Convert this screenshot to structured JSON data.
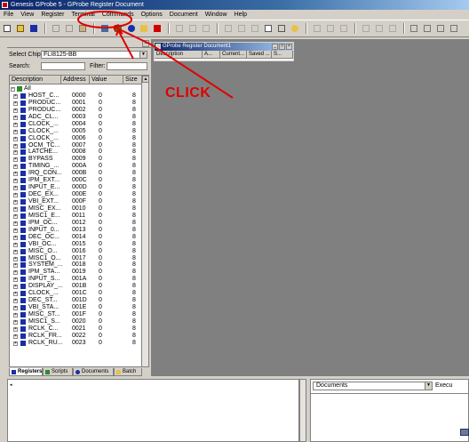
{
  "window": {
    "title": "Genesis GProbe 5 - GProbe Register Document"
  },
  "menu": [
    "File",
    "View",
    "Register",
    "Terminal",
    "Commands",
    "Options",
    "Document",
    "Window",
    "Help"
  ],
  "left_pane": {
    "select_chip_label": "Select Chip:",
    "select_chip_value": "FLI8125-BB",
    "search_label": "Search:",
    "search_value": "",
    "filter_label": "Filter:",
    "filter_value": "",
    "columns": [
      "Description",
      "Address",
      "Value",
      "Size"
    ],
    "root_label": "All",
    "rows": [
      {
        "name": "HOST_C...",
        "addr": "0000",
        "val": "0",
        "size": "8"
      },
      {
        "name": "PRODUC...",
        "addr": "0001",
        "val": "0",
        "size": "8"
      },
      {
        "name": "PRODUC...",
        "addr": "0002",
        "val": "0",
        "size": "8"
      },
      {
        "name": "ADC_CL...",
        "addr": "0003",
        "val": "0",
        "size": "8"
      },
      {
        "name": "CLOCK_...",
        "addr": "0004",
        "val": "0",
        "size": "8"
      },
      {
        "name": "CLOCK_...",
        "addr": "0005",
        "val": "0",
        "size": "8"
      },
      {
        "name": "CLOCK_...",
        "addr": "0006",
        "val": "0",
        "size": "8"
      },
      {
        "name": "OCM_TC...",
        "addr": "0007",
        "val": "0",
        "size": "8"
      },
      {
        "name": "LATCHE...",
        "addr": "0008",
        "val": "0",
        "size": "8"
      },
      {
        "name": "BYPASS",
        "addr": "0009",
        "val": "0",
        "size": "8"
      },
      {
        "name": "TIMING_...",
        "addr": "000A",
        "val": "0",
        "size": "8"
      },
      {
        "name": "IRQ_CON...",
        "addr": "000B",
        "val": "0",
        "size": "8"
      },
      {
        "name": "IPM_EXT...",
        "addr": "000C",
        "val": "0",
        "size": "8"
      },
      {
        "name": "INPUT_E...",
        "addr": "000D",
        "val": "0",
        "size": "8"
      },
      {
        "name": "DEC_EX...",
        "addr": "000E",
        "val": "0",
        "size": "8"
      },
      {
        "name": "VBI_EXT...",
        "addr": "000F",
        "val": "0",
        "size": "8"
      },
      {
        "name": "MISC_EX...",
        "addr": "0010",
        "val": "0",
        "size": "8"
      },
      {
        "name": "MISC1_E...",
        "addr": "0011",
        "val": "0",
        "size": "8"
      },
      {
        "name": "IPM_OC...",
        "addr": "0012",
        "val": "0",
        "size": "8"
      },
      {
        "name": "INPUT_0...",
        "addr": "0013",
        "val": "0",
        "size": "8"
      },
      {
        "name": "DEC_OC...",
        "addr": "0014",
        "val": "0",
        "size": "8"
      },
      {
        "name": "VBI_OC...",
        "addr": "0015",
        "val": "0",
        "size": "8"
      },
      {
        "name": "MISC_O...",
        "addr": "0016",
        "val": "0",
        "size": "8"
      },
      {
        "name": "MISC1_O...",
        "addr": "0017",
        "val": "0",
        "size": "8"
      },
      {
        "name": "SYSTEM_...",
        "addr": "0018",
        "val": "0",
        "size": "8"
      },
      {
        "name": "IPM_STA...",
        "addr": "0019",
        "val": "0",
        "size": "8"
      },
      {
        "name": "INPUT_S...",
        "addr": "001A",
        "val": "0",
        "size": "8"
      },
      {
        "name": "DISPLAY_...",
        "addr": "001B",
        "val": "0",
        "size": "8"
      },
      {
        "name": "CLOCK_...",
        "addr": "001C",
        "val": "0",
        "size": "8"
      },
      {
        "name": "DEC_ST...",
        "addr": "001D",
        "val": "0",
        "size": "8"
      },
      {
        "name": "VBI_STA...",
        "addr": "001E",
        "val": "0",
        "size": "8"
      },
      {
        "name": "MISC_ST...",
        "addr": "001F",
        "val": "0",
        "size": "8"
      },
      {
        "name": "MISC1_S...",
        "addr": "0020",
        "val": "0",
        "size": "8"
      },
      {
        "name": "RCLK_C...",
        "addr": "0021",
        "val": "0",
        "size": "8"
      },
      {
        "name": "RCLK_FR...",
        "addr": "0022",
        "val": "0",
        "size": "8"
      },
      {
        "name": "RCLK_RU...",
        "addr": "0023",
        "val": "0",
        "size": "8"
      }
    ],
    "tabs": [
      "Registers",
      "Scripts",
      "Documents",
      "Batch"
    ]
  },
  "child_window": {
    "title": "GProbe Register Document1",
    "columns": [
      "Description",
      "A...",
      "Current...",
      "Saved ...",
      "S..."
    ]
  },
  "annotation": {
    "text": "CLICK",
    "color": "#e00000"
  },
  "bottom": {
    "right_select_value": "Documents",
    "execute_label": "Execu"
  }
}
